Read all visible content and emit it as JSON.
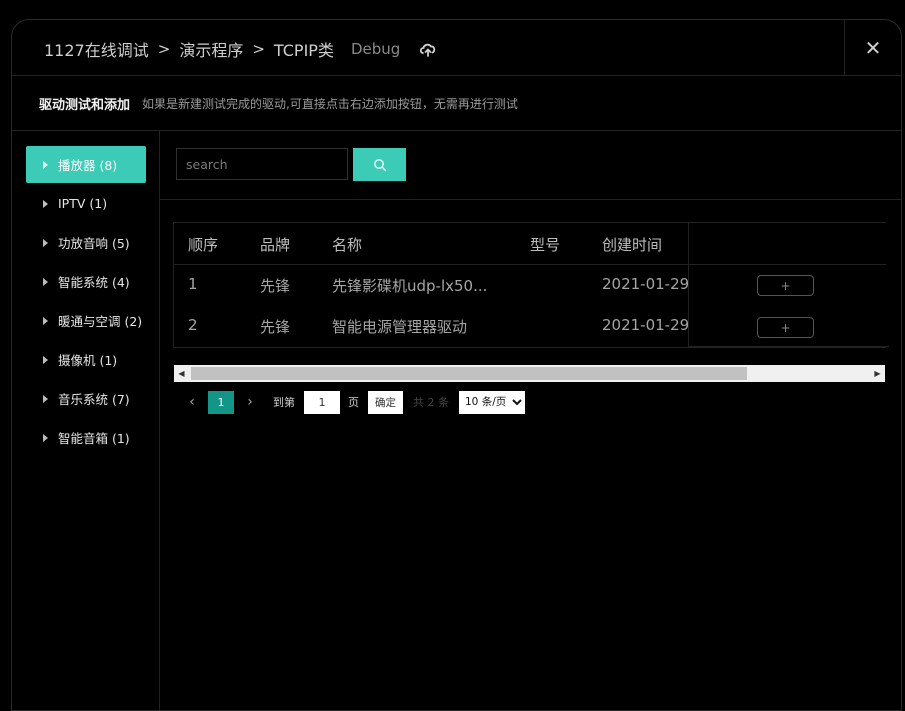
{
  "breadcrumb": {
    "items": [
      "1127在线调试",
      "演示程序",
      "TCPIP类"
    ],
    "separator": ">",
    "status": "Debug"
  },
  "close_label": "✕",
  "subheader": {
    "title": "驱动测试和添加",
    "description": "如果是新建测试完成的驱动,可直接点击右边添加按钮，无需再进行测试"
  },
  "sidebar": {
    "items": [
      {
        "label": "播放器 (8)",
        "active": true
      },
      {
        "label": "IPTV (1)",
        "active": false
      },
      {
        "label": "功放音响 (5)",
        "active": false
      },
      {
        "label": "智能系统 (4)",
        "active": false
      },
      {
        "label": "暖通与空调 (2)",
        "active": false
      },
      {
        "label": "摄像机 (1)",
        "active": false
      },
      {
        "label": "音乐系统 (7)",
        "active": false
      },
      {
        "label": "智能音箱 (1)",
        "active": false
      }
    ]
  },
  "search": {
    "placeholder": "search",
    "value": ""
  },
  "table": {
    "columns": [
      "顺序",
      "品牌",
      "名称",
      "型号",
      "创建时间"
    ],
    "rows": [
      {
        "index": "1",
        "brand": "先锋",
        "name": "先锋影碟机udp-lx50...",
        "model": "",
        "created": "2021-01-29",
        "action": "+"
      },
      {
        "index": "2",
        "brand": "先锋",
        "name": "智能电源管理器驱动",
        "model": "",
        "created": "2021-01-29",
        "action": "+"
      }
    ]
  },
  "pagination": {
    "prev": "‹",
    "next": "›",
    "current_page": "1",
    "goto_label": "到第",
    "goto_value": "1",
    "page_unit": "页",
    "confirm": "确定",
    "total": "共 2 条",
    "page_size": "10 条/页"
  },
  "colors": {
    "accent": "#3ccbb7",
    "pager_active": "#119688",
    "background": "#000000"
  }
}
